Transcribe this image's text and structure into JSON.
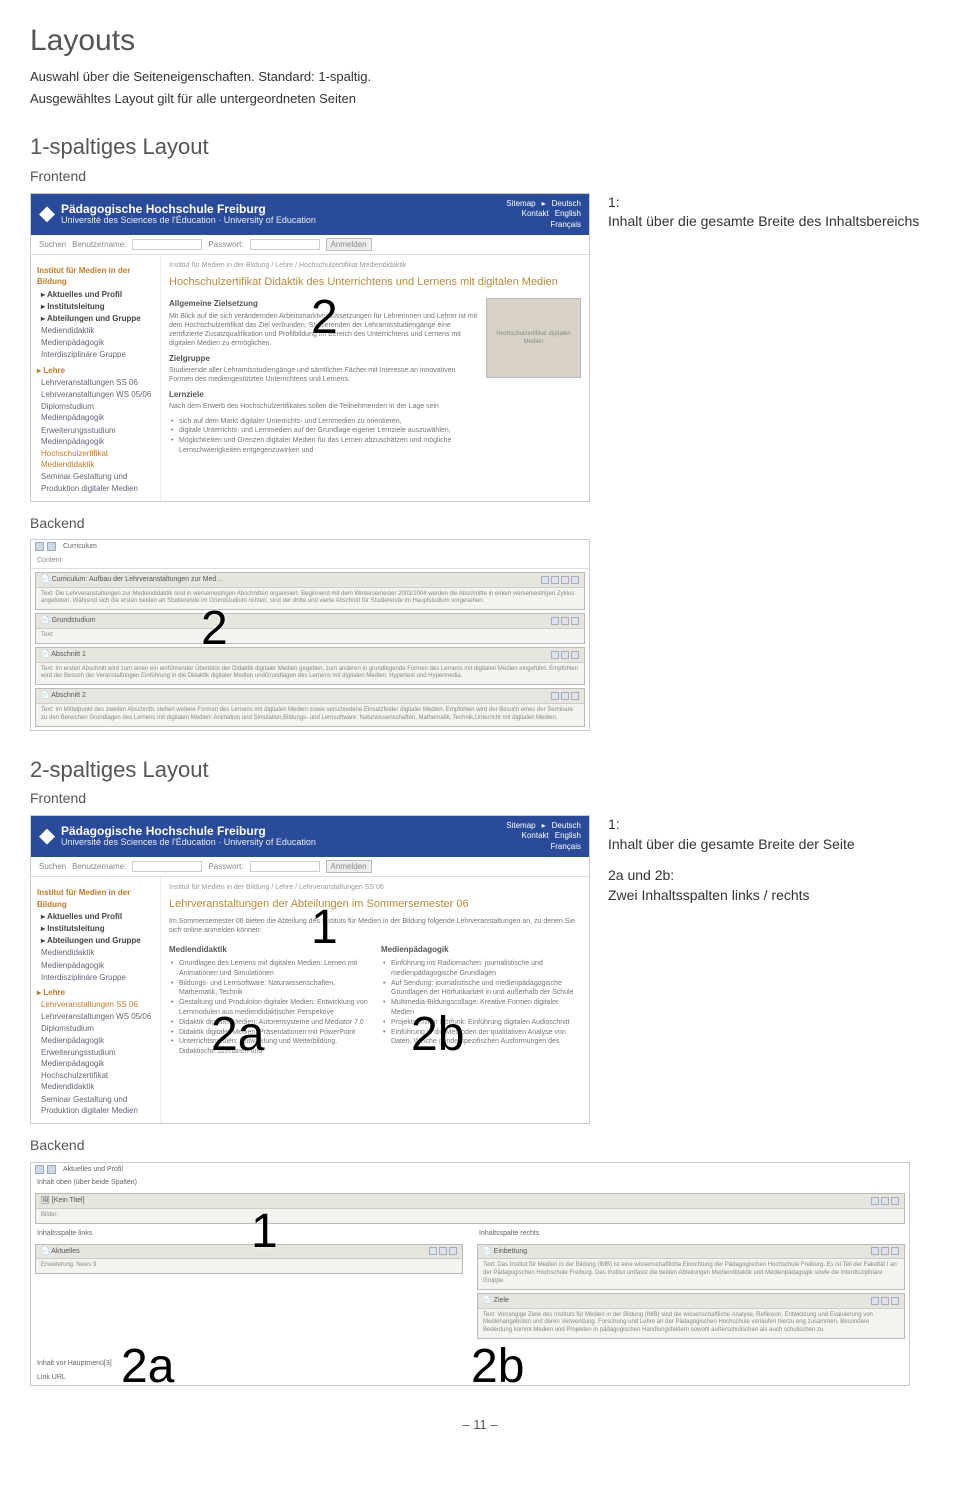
{
  "page": {
    "title": "Layouts",
    "intro1": "Auswahl über die Seiteneigenschaften. Standard: 1-spaltig.",
    "intro2": "Ausgewähltes Layout gilt für alle untergeordneten Seiten",
    "footer": "– 11 –"
  },
  "layout1": {
    "heading": "1-spaltiges Layout",
    "frontend_label": "Frontend",
    "backend_label": "Backend",
    "desc_label": "1:",
    "desc_text": "Inhalt über die gesamte Breite des Inhaltsbereichs",
    "overlay_fe": "2",
    "overlay_be": "2"
  },
  "layout2": {
    "heading": "2-spaltiges Layout",
    "frontend_label": "Frontend",
    "backend_label": "Backend",
    "desc1_label": "1:",
    "desc1_text": "Inhalt über die gesamte Breite der Seite",
    "desc2_label": "2a und 2b:",
    "desc2_text": "Zwei Inhaltsspalten links / rechts",
    "ov_fe_1": "1",
    "ov_fe_2a": "2a",
    "ov_fe_2b": "2b",
    "ov_be_1": "1",
    "ov_be_2a": "2a",
    "ov_be_2b": "2b"
  },
  "site": {
    "name": "Pädagogische Hochschule Freiburg",
    "subname": "Université des Sciences de l'Éducation · University of Education",
    "top_links": [
      "Sitemap",
      "Kontakt",
      "Deutsch",
      "English",
      "Français"
    ],
    "login": {
      "search": "Suchen",
      "user": "Benutzername:",
      "pass": "Passwort:",
      "submit": "Anmelden"
    },
    "breadcrumb1": "Institut für Medien in der Bildung / Lehre / Hochschulzertifikat Mediendidaktik",
    "breadcrumb2": "Institut für Medien in der Bildung / Lehre / Lehrveranstaltungen SS 06"
  },
  "nav": {
    "section": "Institut für Medien in der Bildung",
    "items1": [
      "Aktuelles und Profil",
      "Institutsleitung",
      "Abteilungen und Gruppe",
      "Mediendidaktik",
      "Medienpädagogik",
      "Interdisziplinäre Gruppe"
    ],
    "lehre": "Lehre",
    "items2": [
      "Lehrveranstaltungen SS 06",
      "Lehrveranstaltungen WS 05/06",
      "Diplomstudium Medienpädagogik",
      "Erweiterungsstudium Medienpädagogik",
      "Hochschulzertifikat Mediendidaktik",
      "Seminar Gestaltung und Produktion digitaler Medien"
    ]
  },
  "content1": {
    "h1": "Hochschulzertifikat Didaktik des Unterrichtens und Lernens mit digitalen Medien",
    "s1": "Allgemeine Zielsetzung",
    "p1": "Mit Blick auf die sich verändernden Arbeitsmarktvoraussetzungen für Lehrerinnen und Lehrer ist mit dem Hochschulzertifikat das Ziel verbunden, Studierenden der Lehramtsstudiengänge eine zertifizierte Zusatzqualifikation und Profilbildung im Bereich des Unterrichtens und Lernens mit digitalen Medien zu ermöglichen.",
    "s2": "Zielgruppe",
    "p2": "Studierende aller Lehramtsstudiengänge und sämtlicher Fächer mit Interesse an innovativen Formen des mediengestützten Unterrichtens und Lernens.",
    "s3": "Lernziele",
    "p3": "Nach dem Erwerb des Hochschulzertifikates sollen die Teilnehmenden in der Lage sein",
    "li1": "sich auf dem Markt digitaler Unterrichts- und Lernmedien zu orientieren,",
    "li2": "digitale Unterrichts- und Lernmedien auf der Grundlage eigener Lernziele auszuwählen,",
    "li3": "Möglichkeiten und Grenzen digitaler Medien für das Lernen abzuschätzen und mögliche Lernschwierigkeiten entgegenzuwirken und",
    "img_caption": "Hochschulzertifikat digitalen Medien"
  },
  "content2": {
    "h1": "Lehrveranstaltungen der Abteilungen im Sommersemester 06",
    "intro": "Im Sommersemester 06 bieten die Abteilung des Instituts für Medien in der Bildung folgende Lehrveranstaltungen an, zu denen Sie sich online anmelden können:",
    "colA": "Mediendidaktik",
    "a1": "Grundlagen des Lernens mit digitalen Medien: Lernen mit Animationen und Simulationen",
    "a2": "Bildungs- und Lernsoftware: Naturwissenschaften, Mathematik, Technik",
    "a3": "Gestaltung und Produktion digitaler Medien: Entwicklung von Lernmodulen aus mediendidaktischer Perspektive",
    "a4": "Didaktik digitaler Medien: Autorensysteme und Mediator 7.0",
    "a5": "Didaktik digitaler Medien: Präsentationen mit PowerPoint",
    "a6": "Unterrichtsmedien: Entwicklung und Weiterbildung. Didaktische Szenarien und",
    "colB": "Medienpädagogik",
    "b1": "Einführung ins Radiomachen: journalistische und medienpädagogische Grundlagen",
    "b2": "Auf Sendung: journalistische und medienpädagogische Grundlagen der Hörfunkarbeit in und außerhalb der Schule",
    "b3": "Multimedia-Bildungscollage: Kreative Formen digitaler Medien",
    "b4": "Projektseminar Hörfunk: Einführung digitalen Audioschnitt",
    "b5": "Einführung in die Methoden der qualitativen Analyse von Daten. Welche genderspezifischen Ausformungen des"
  },
  "be1": {
    "top": "Curriculum",
    "h": "Content",
    "b1_h": "Curriculum: Aufbau der Lehrveranstaltungen zur Med…",
    "b1_t": "Text: Die Lehrveranstaltungen zur Mediendidaktik sind in viersemestrigen Abschnitten organisiert. Beginnend mit dem Wintersemester 2003/2004 werden die Abschnitte in einem viersemestrigen Zyklus angeboten. Während sich die ersten beiden an Studierende im Grundstudium richten, sind der dritte und vierte Abschnitt für Studierende im Hauptstudium vorgesehen.",
    "b2_h": "Grundstudium",
    "b2_t": "Text:",
    "b3_h": "Abschnitt 1",
    "b3_t": "Text: Im ersten Abschnitt wird zum einen ein einführender Überblick der Didaktik digitaler Medien gegeben, zum anderen in grundlegende Formen des Lernens mit digitalen Medien eingeführt. Empfohlen wird der Besuch der Veranstaltungen Einführung in die Didaktik digitaler Medien undGrundlagen des Lernens mit digitalen Medien: Hypertext und Hypermedia.",
    "b4_h": "Abschnitt 2",
    "b4_t": "Text: Im Mittelpunkt des zweiten Abschnitts stehen weitere Formen des Lernens mit digitalen Medien sowie verschiedene Einsatzfelder digitaler Medien. Empfohlen wird der Besuch eines der Seminare zu den Bereichen Grundlagen des Lernens mit digitalen Medien: Animation und Simulation,Bildungs- und Lernsoftware: Naturwissenschaften, Mathematik, Technik,Unterricht mit digitalen Medien."
  },
  "be2": {
    "top": "Aktuelles und Profil",
    "h1": "Inhalt oben (über beide Spalten)",
    "b1_h": "[Kein Titel]",
    "b1_t": "Bilder:",
    "left": "Inhaltsspalte links",
    "right": "Inhaltsspalte rechts",
    "l1_h": "Aktuelles",
    "l1_t": "Erweiterung: News 9",
    "r1_h": "Einbettung",
    "r1_t": "Text: Das Institut für Medien in der Bildung (IMB) ist eine wissenschaftliche Einrichtung der Pädagogischen Hochschule Freiburg. Es ist Teil der Fakultät I an der Pädagogischen Hochschule Freiburg. Das Institut umfasst die beiden Abteilungen Mediendidaktik und Medienpädagogik sowie die interdisziplinäre Gruppe.",
    "r2_h": "Ziele",
    "r2_t": "Text: Vorrangige Ziele des Instituts für Medien in der Bildung (IMB) sind die wissenschaftliche Analyse, Reflexion, Entwicklung und Evaluierung von Medienangeboten und deren Verwendung. Forschung und Lehre an der Pädagogischen Hochschule verlaufen hierzu eng zusammen. Besondere Bedeutung kommt Medien und Projekten in pädagogischen Handlungsfeldern sowohl außerschulischen als auch schulischen zu.",
    "foot1": "Inhalt vor Hauptmenü[3]",
    "foot2": "Link URL"
  }
}
